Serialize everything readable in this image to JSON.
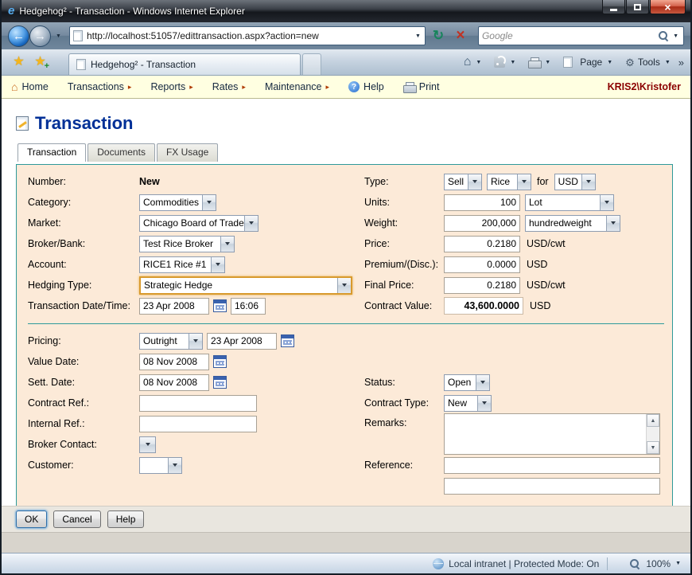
{
  "window": {
    "title": "Hedgehog² - Transaction - Windows Internet Explorer"
  },
  "browser": {
    "url": "http://localhost:51057/edittransaction.aspx?action=new",
    "search_placeholder": "Google",
    "tab_title": "Hedgehog² - Transaction",
    "page_label": "Page",
    "tools_label": "Tools"
  },
  "nav": {
    "home": "Home",
    "transactions": "Transactions",
    "reports": "Reports",
    "rates": "Rates",
    "maintenance": "Maintenance",
    "help": "Help",
    "print": "Print",
    "user": "KRIS2\\Kristofer"
  },
  "page": {
    "title": "Transaction",
    "tabs": {
      "transaction": "Transaction",
      "documents": "Documents",
      "fx_usage": "FX Usage"
    }
  },
  "form": {
    "number": {
      "label": "Number:",
      "value": "New"
    },
    "type": {
      "label": "Type:",
      "side": "Sell",
      "commodity": "Rice",
      "for_label": "for",
      "currency": "USD"
    },
    "category": {
      "label": "Category:",
      "value": "Commodities"
    },
    "units": {
      "label": "Units:",
      "value": "100",
      "uom": "Lot"
    },
    "market": {
      "label": "Market:",
      "value": "Chicago Board of Trade"
    },
    "weight": {
      "label": "Weight:",
      "value": "200,000",
      "uom": "hundredweight"
    },
    "broker_bank": {
      "label": "Broker/Bank:",
      "value": "Test Rice Broker"
    },
    "price": {
      "label": "Price:",
      "value": "0.2180",
      "unit": "USD/cwt"
    },
    "account": {
      "label": "Account:",
      "value": "RICE1 Rice #1"
    },
    "premium": {
      "label": "Premium/(Disc.):",
      "value": "0.0000",
      "unit": "USD"
    },
    "hedging_type": {
      "label": "Hedging Type:",
      "value": "Strategic Hedge"
    },
    "final_price": {
      "label": "Final Price:",
      "value": "0.2180",
      "unit": "USD/cwt"
    },
    "transaction_datetime": {
      "label": "Transaction Date/Time:",
      "date": "23 Apr 2008",
      "time": "16:06"
    },
    "contract_value": {
      "label": "Contract Value:",
      "value": "43,600.0000",
      "unit": "USD"
    },
    "pricing": {
      "label": "Pricing:",
      "value": "Outright",
      "date": "23 Apr 2008"
    },
    "value_date": {
      "label": "Value Date:",
      "value": "08 Nov 2008"
    },
    "sett_date": {
      "label": "Sett. Date:",
      "value": "08 Nov 2008"
    },
    "contract_ref": {
      "label": "Contract Ref.:",
      "value": ""
    },
    "internal_ref": {
      "label": "Internal Ref.:",
      "value": ""
    },
    "broker_contact": {
      "label": "Broker Contact:",
      "value": ""
    },
    "customer": {
      "label": "Customer:",
      "value": ""
    },
    "status": {
      "label": "Status:",
      "value": "Open"
    },
    "contract_type": {
      "label": "Contract Type:",
      "value": "New"
    },
    "remarks": {
      "label": "Remarks:",
      "value": ""
    },
    "reference": {
      "label": "Reference:",
      "value1": "",
      "value2": ""
    }
  },
  "actions": {
    "ok": "OK",
    "cancel": "Cancel",
    "help": "Help"
  },
  "status_bar": {
    "zone": "Local intranet | Protected Mode: On",
    "zoom": "100%"
  },
  "icons": {
    "ie_logo": "e",
    "close": "×",
    "back": "←",
    "forward": "→",
    "chevron_down": "▼",
    "refresh": "↻",
    "stop": "×",
    "star": "★",
    "star_plus": "+",
    "house": "⌂",
    "gear": "⚙",
    "overflow": "»",
    "submenu_arrow": "▸",
    "help": "?",
    "scroll_up": "▲",
    "scroll_down": "▼"
  },
  "theme": {
    "heading_color": "#003097",
    "user_color": "#8b0000",
    "panel_bg": "#fcead8",
    "panel_border": "#2e9a9a",
    "menu_bg": "#ffffe1",
    "focus_border": "#d89a2e"
  }
}
